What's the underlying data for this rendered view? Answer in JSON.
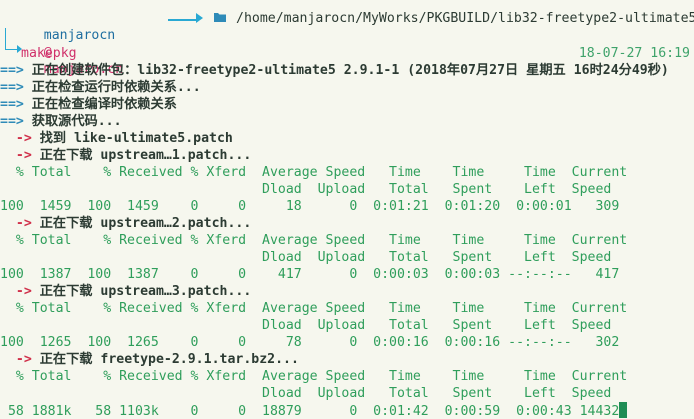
{
  "prompt": {
    "user": "manjarocn",
    "at": "@",
    "host": "manjaro.cn",
    "arrow": "->",
    "folder_icon": "folder-icon",
    "path": "/home/manjarocn/MyWorks/PKGBUILD/lib32-freetype2-ultimate5",
    "command": "makepkg",
    "timestamp": "18-07-27 16:19"
  },
  "lines": [
    "==> 正在创建软件包：lib32-freetype2-ultimate5 2.9.1-1 (2018年07月27日 星期五 16时24分49秒)",
    "==> 正在检查运行时依赖关系...",
    "==> 正在检查编译时依赖关系",
    "==> 获取源代码...",
    "  -> 找到 like-ultimate5.patch",
    "  -> 正在下载 upstream…1.patch...",
    "  % Total    % Received % Xferd  Average Speed   Time    Time     Time  Current",
    "                                 Dload  Upload   Total   Spent    Left  Speed",
    "100  1459  100  1459    0     0     18      0  0:01:21  0:01:20  0:00:01   309",
    "  -> 正在下载 upstream…2.patch...",
    "  % Total    % Received % Xferd  Average Speed   Time    Time     Time  Current",
    "                                 Dload  Upload   Total   Spent    Left  Speed",
    "100  1387  100  1387    0     0    417      0  0:00:03  0:00:03 --:--:--   417",
    "  -> 正在下载 upstream…3.patch...",
    "  % Total    % Received % Xferd  Average Speed   Time    Time     Time  Current",
    "                                 Dload  Upload   Total   Spent    Left  Speed",
    "100  1265  100  1265    0     0     78      0  0:00:16  0:00:16 --:--:--   302",
    "  -> 正在下载 freetype-2.9.1.tar.bz2...",
    "  % Total    % Received % Xferd  Average Speed   Time    Time     Time  Current",
    "                                 Dload  Upload   Total   Spent    Left  Speed",
    " 58 1881k   58 1103k    0     0  18879      0  0:01:42  0:00:59  0:00:43 14432"
  ]
}
